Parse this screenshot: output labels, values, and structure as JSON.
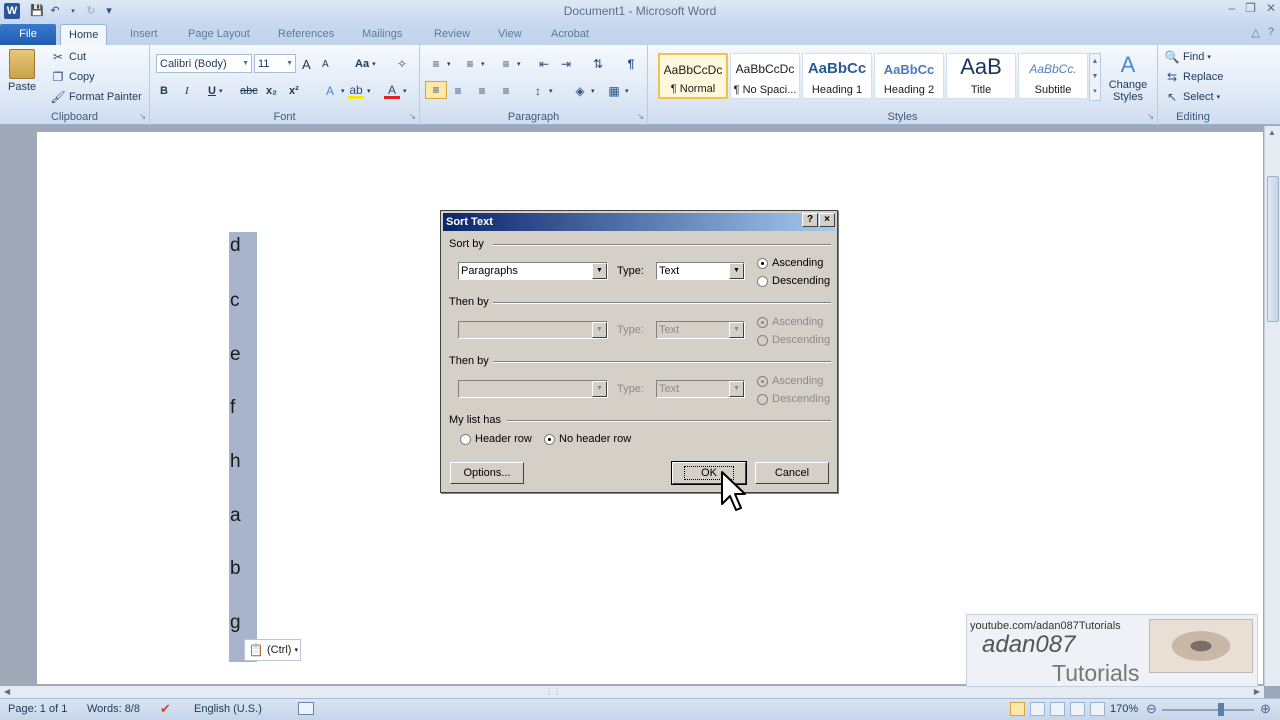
{
  "window": {
    "title": "Document1  -  Microsoft Word"
  },
  "qat": {
    "word_icon": "word-logo-icon",
    "save": "save-icon",
    "undo": "undo-icon",
    "redo": "redo-icon",
    "customize": "customize-qat-icon"
  },
  "tabs": [
    {
      "label": "File",
      "active": false
    },
    {
      "label": "Home",
      "active": true
    },
    {
      "label": "Insert",
      "active": false
    },
    {
      "label": "Page Layout",
      "active": false
    },
    {
      "label": "References",
      "active": false
    },
    {
      "label": "Mailings",
      "active": false
    },
    {
      "label": "Review",
      "active": false
    },
    {
      "label": "View",
      "active": false
    },
    {
      "label": "Acrobat",
      "active": false
    }
  ],
  "clipboard": {
    "paste": "Paste",
    "cut": "Cut",
    "copy": "Copy",
    "format_painter": "Format Painter",
    "label": "Clipboard"
  },
  "font": {
    "name": "Calibri (Body)",
    "size": "11",
    "label": "Font",
    "bold": "B",
    "italic": "I",
    "underline": "U",
    "strike": "abc",
    "subscript": "x₂",
    "superscript": "x²",
    "change_case": "Aa",
    "grow": "A",
    "shrink": "A"
  },
  "paragraph": {
    "label": "Paragraph"
  },
  "styles": {
    "label": "Styles",
    "items": [
      {
        "sample": "AaBbCcDc",
        "name": "¶ Normal",
        "selected": true
      },
      {
        "sample": "AaBbCcDc",
        "name": "¶ No Spaci...",
        "selected": false
      },
      {
        "sample": "AaBbCc",
        "name": "Heading 1",
        "selected": false
      },
      {
        "sample": "AaBbCc",
        "name": "Heading 2",
        "selected": false
      },
      {
        "sample": "AaB",
        "name": "Title",
        "selected": false
      },
      {
        "sample": "AaBbCc.",
        "name": "Subtitle",
        "selected": false
      }
    ],
    "change_styles": "Change Styles"
  },
  "editing": {
    "label": "Editing",
    "find": "Find",
    "replace": "Replace",
    "select": "Select"
  },
  "document": {
    "lines": [
      "d",
      "c",
      "e",
      "f",
      "h",
      "a",
      "b",
      "g"
    ],
    "paste_options": "(Ctrl)"
  },
  "dialog": {
    "title": "Sort Text",
    "help": "?",
    "close": "×",
    "sort_by_label": "Sort by",
    "sort_by_value": "Paragraphs",
    "type_label": "Type:",
    "type_value": "Text",
    "ascending": "Ascending",
    "descending": "Descending",
    "then_by_label": "Then by",
    "then_by_2_label": "Then by",
    "my_list_has": "My list has",
    "header_row": "Header row",
    "no_header_row": "No header row",
    "options": "Options...",
    "ok": "OK",
    "cancel": "Cancel"
  },
  "watermark": {
    "url": "youtube.com/adan087Tutorials",
    "name": "adan087",
    "sub": "Tutorials"
  },
  "statusbar": {
    "page": "Page: 1 of 1",
    "words": "Words: 8/8",
    "language": "English (U.S.)",
    "zoom": "170%",
    "zoom_fraction": 0.64
  }
}
